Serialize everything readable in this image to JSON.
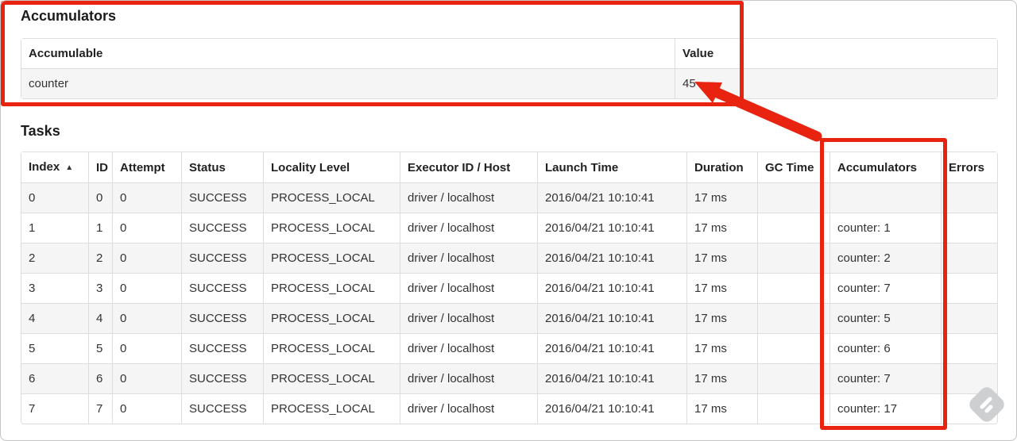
{
  "annotation": {
    "color": "#e8230f"
  },
  "accumulators": {
    "title": "Accumulators",
    "headers": [
      "Accumulable",
      "Value"
    ],
    "rows": [
      [
        "counter",
        "45"
      ]
    ]
  },
  "tasks": {
    "title": "Tasks",
    "headers": [
      {
        "label": "Index",
        "sort": "▲"
      },
      "ID",
      "Attempt",
      "Status",
      "Locality Level",
      "Executor ID / Host",
      "Launch Time",
      "Duration",
      "GC Time",
      "Accumulators",
      "Errors"
    ],
    "rows": [
      [
        "0",
        "0",
        "0",
        "SUCCESS",
        "PROCESS_LOCAL",
        "driver / localhost",
        "2016/04/21 10:10:41",
        "17 ms",
        "",
        "",
        ""
      ],
      [
        "1",
        "1",
        "0",
        "SUCCESS",
        "PROCESS_LOCAL",
        "driver / localhost",
        "2016/04/21 10:10:41",
        "17 ms",
        "",
        "counter: 1",
        ""
      ],
      [
        "2",
        "2",
        "0",
        "SUCCESS",
        "PROCESS_LOCAL",
        "driver / localhost",
        "2016/04/21 10:10:41",
        "17 ms",
        "",
        "counter: 2",
        ""
      ],
      [
        "3",
        "3",
        "0",
        "SUCCESS",
        "PROCESS_LOCAL",
        "driver / localhost",
        "2016/04/21 10:10:41",
        "17 ms",
        "",
        "counter: 7",
        ""
      ],
      [
        "4",
        "4",
        "0",
        "SUCCESS",
        "PROCESS_LOCAL",
        "driver / localhost",
        "2016/04/21 10:10:41",
        "17 ms",
        "",
        "counter: 5",
        ""
      ],
      [
        "5",
        "5",
        "0",
        "SUCCESS",
        "PROCESS_LOCAL",
        "driver / localhost",
        "2016/04/21 10:10:41",
        "17 ms",
        "",
        "counter: 6",
        ""
      ],
      [
        "6",
        "6",
        "0",
        "SUCCESS",
        "PROCESS_LOCAL",
        "driver / localhost",
        "2016/04/21 10:10:41",
        "17 ms",
        "",
        "counter: 7",
        ""
      ],
      [
        "7",
        "7",
        "0",
        "SUCCESS",
        "PROCESS_LOCAL",
        "driver / localhost",
        "2016/04/21 10:10:41",
        "17 ms",
        "",
        "counter: 17",
        ""
      ]
    ]
  },
  "watermark": {
    "icon": "feedly-icon"
  }
}
